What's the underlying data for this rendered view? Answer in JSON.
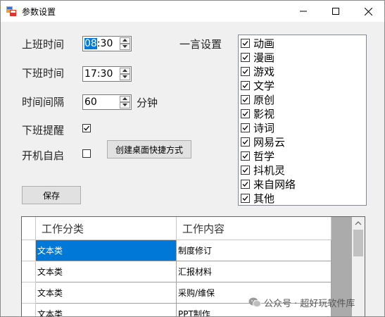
{
  "window": {
    "title": "参数设置"
  },
  "settings": {
    "work_start_label": "上班时间",
    "work_start_hour": "08",
    "work_start_rest": ":30",
    "work_end_label": "下班时间",
    "work_end_value": "17:30",
    "interval_label": "时间间隔",
    "interval_value": "60",
    "interval_unit": "分钟",
    "reminder_label": "下班提醒",
    "reminder_checked": true,
    "autostart_label": "开机自启",
    "autostart_checked": false,
    "shortcut_button": "创建桌面快捷方式",
    "save_button": "保存"
  },
  "quotes": {
    "label": "一言设置",
    "items": [
      {
        "label": "动画",
        "checked": true
      },
      {
        "label": "漫画",
        "checked": true
      },
      {
        "label": "游戏",
        "checked": true
      },
      {
        "label": "文学",
        "checked": true
      },
      {
        "label": "原创",
        "checked": true
      },
      {
        "label": "影视",
        "checked": true
      },
      {
        "label": "诗词",
        "checked": true
      },
      {
        "label": "网易云",
        "checked": true
      },
      {
        "label": "哲学",
        "checked": true
      },
      {
        "label": "抖机灵",
        "checked": true
      },
      {
        "label": "来自网络",
        "checked": true
      },
      {
        "label": "其他",
        "checked": true
      }
    ]
  },
  "table": {
    "columns": [
      "工作分类",
      "工作内容"
    ],
    "rows": [
      [
        "文本类",
        "制度修订"
      ],
      [
        "文本类",
        "汇报材料"
      ],
      [
        "文本类",
        "采购/维保"
      ],
      [
        "文本类",
        "PPT制作"
      ]
    ]
  },
  "watermark": "公众号 · 超好玩软件库"
}
